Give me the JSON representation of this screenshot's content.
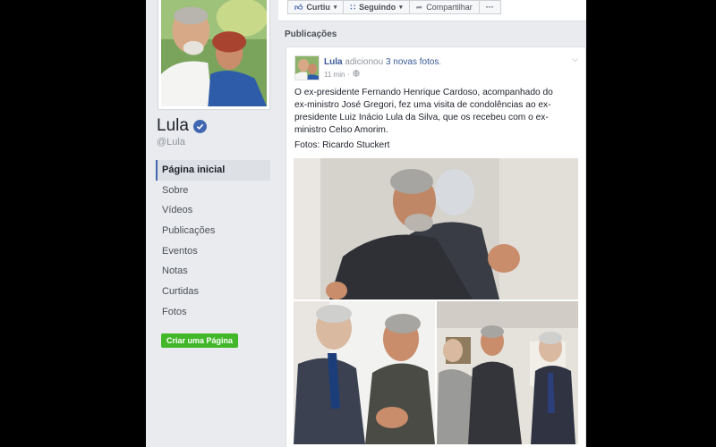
{
  "page": {
    "name": "Lula",
    "handle": "@Lula",
    "create_page_label": "Criar uma Página"
  },
  "sidebar": {
    "items": [
      {
        "label": "Página inicial",
        "active": true
      },
      {
        "label": "Sobre"
      },
      {
        "label": "Vídeos"
      },
      {
        "label": "Publicações"
      },
      {
        "label": "Eventos"
      },
      {
        "label": "Notas"
      },
      {
        "label": "Curtidas"
      },
      {
        "label": "Fotos"
      }
    ]
  },
  "actions": {
    "like": "Curtiu",
    "following": "Seguindo",
    "share": "Compartilhar",
    "more": "···"
  },
  "feed": {
    "section_title": "Publicações"
  },
  "post": {
    "author": "Lula",
    "action_text": "adicionou",
    "link_text": "3 novas fotos",
    "period": ".",
    "time": "11 min",
    "separator": "·",
    "body": "O ex-presidente Fernando Henrique Cardoso, acompanhado do ex-ministro José Gregori, fez uma visita de condolências ao ex-presidente Luiz Inácio Lula da Silva, que os recebeu com o ex-ministro Celso Amorim.",
    "credit": "Fotos: Ricardo Stuckert"
  },
  "icons": {
    "like": "thumbs-up-icon",
    "following": "rss-icon",
    "share": "share-arrow-icon",
    "verified": "verified-check-icon",
    "globe": "globe-icon",
    "options": "chevron-down-icon"
  },
  "colors": {
    "brand_blue": "#4267b2",
    "link_blue": "#385898",
    "create_green": "#42b72a",
    "background": "#e9ebee"
  }
}
